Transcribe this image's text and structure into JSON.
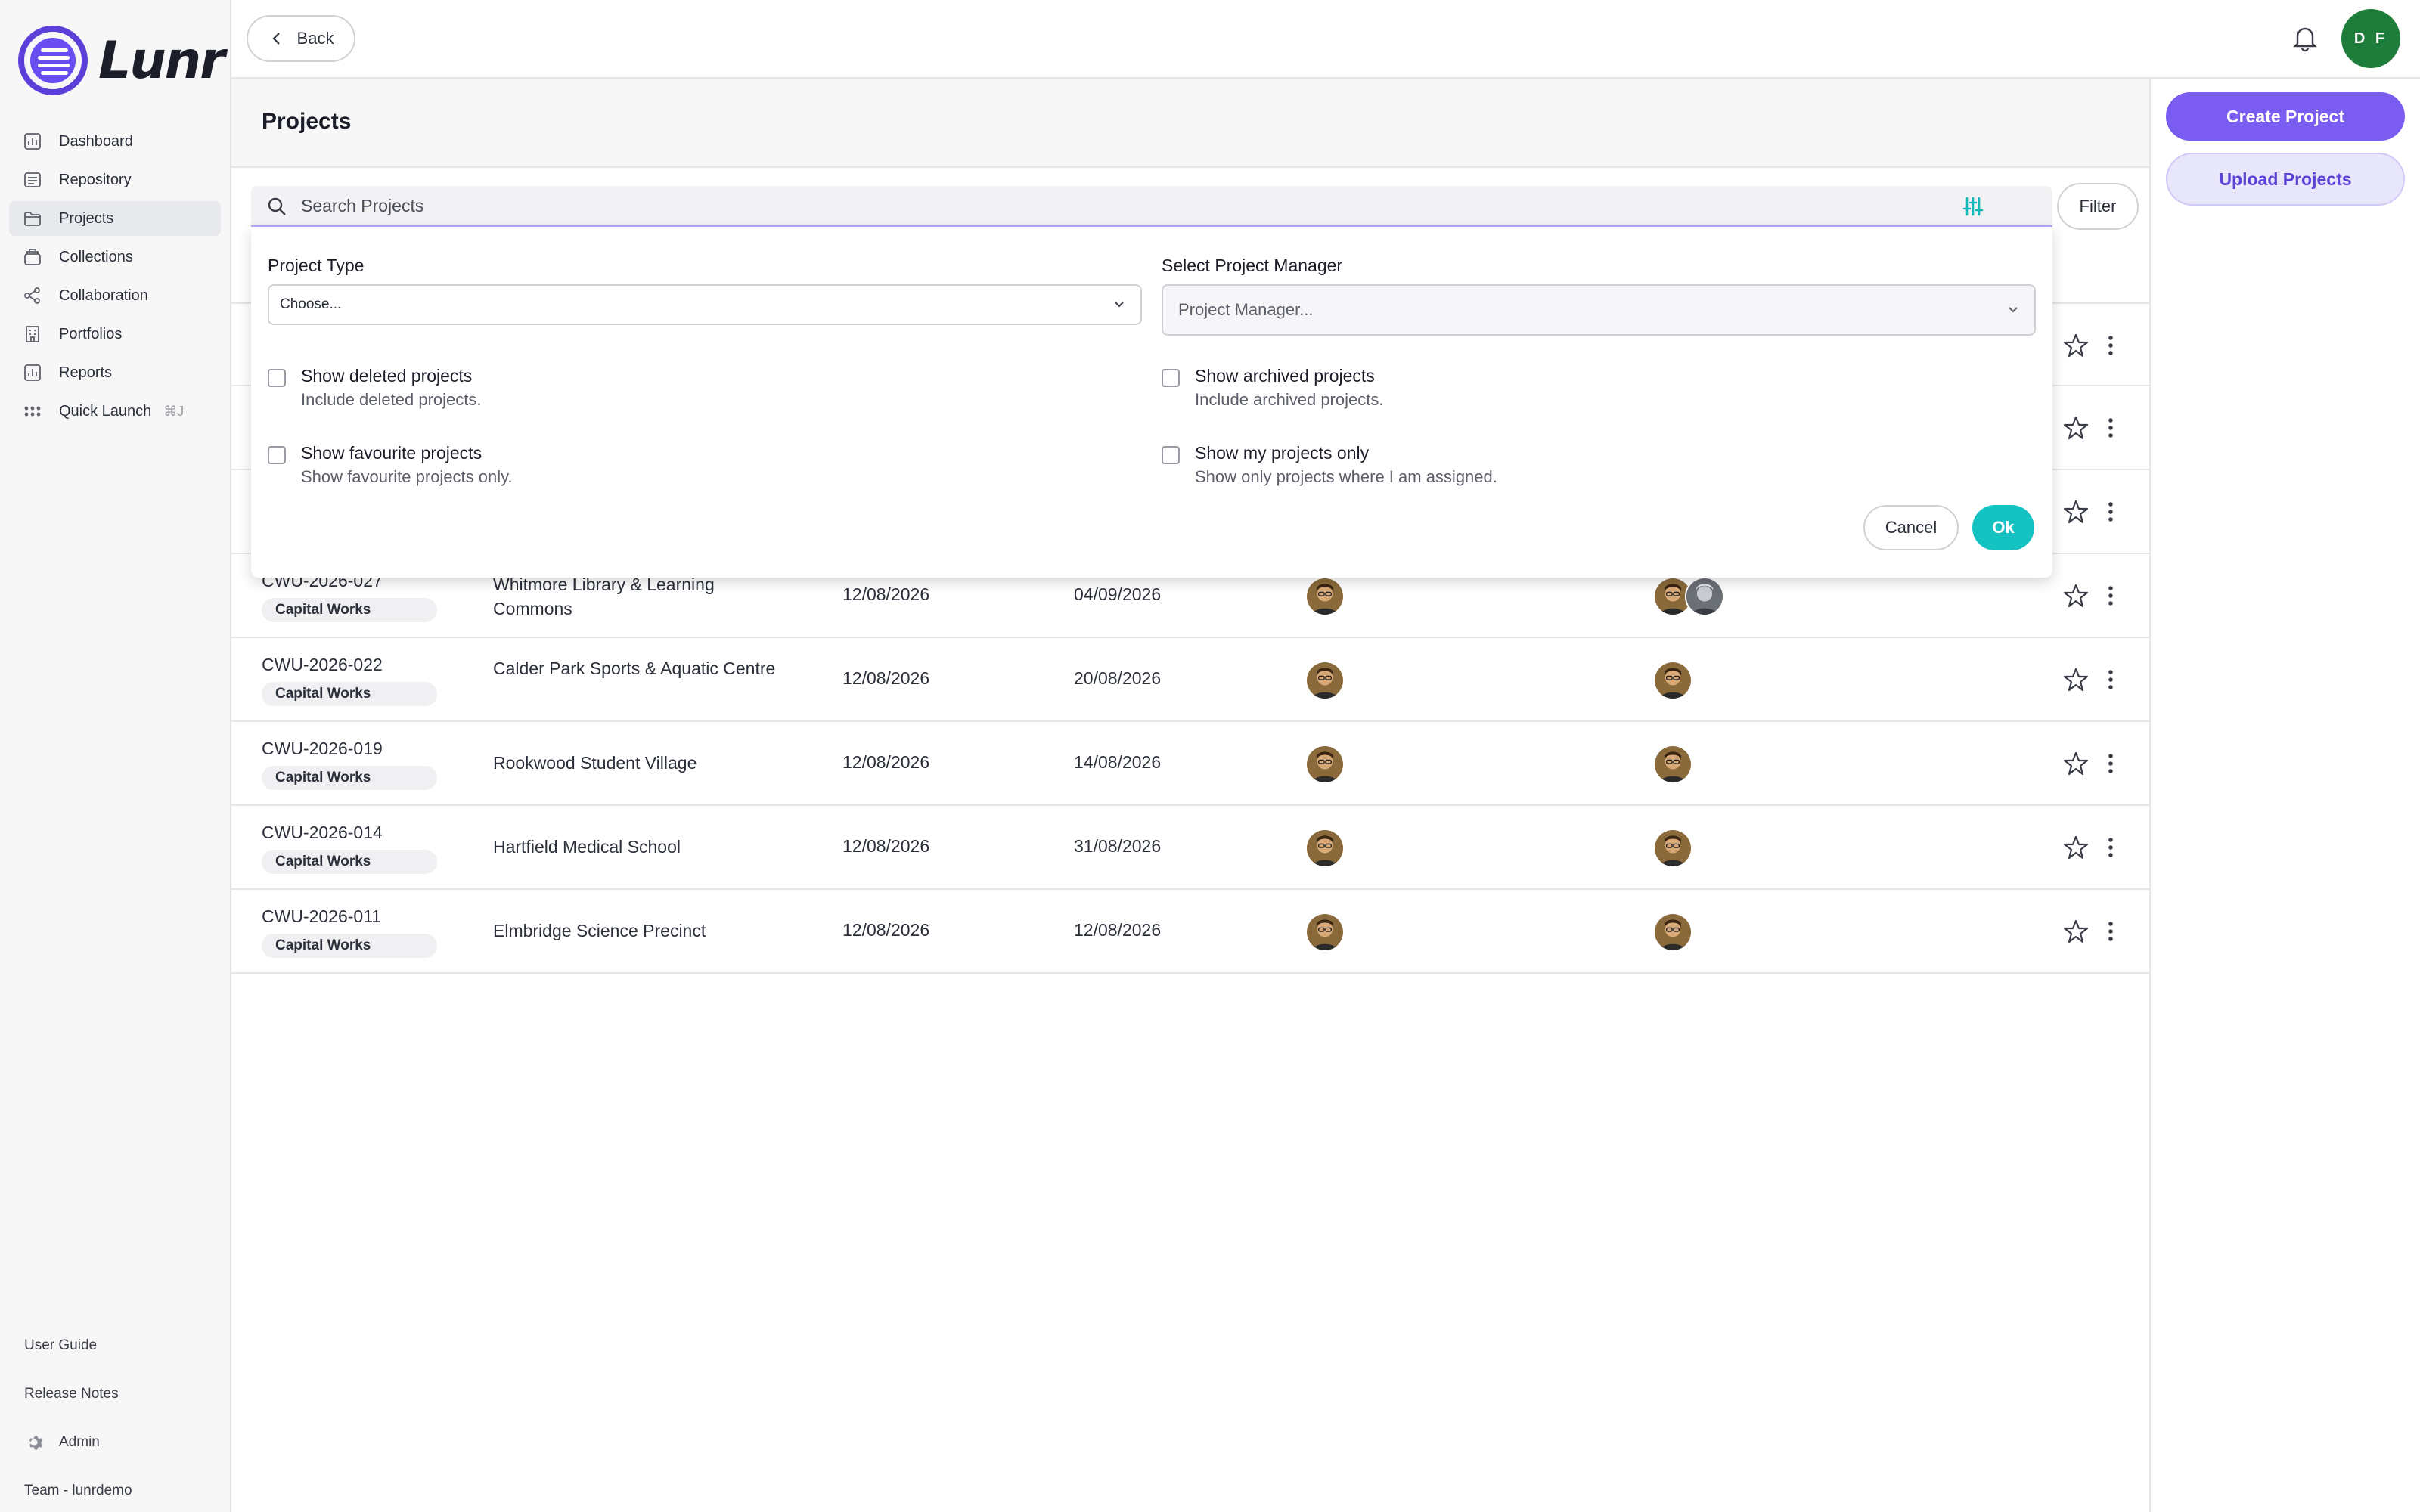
{
  "app": {
    "name": "Lunr"
  },
  "sidebar": {
    "items": [
      {
        "label": "Dashboard",
        "icon": "bar-chart-icon"
      },
      {
        "label": "Repository",
        "icon": "repository-icon"
      },
      {
        "label": "Projects",
        "icon": "folder-icon",
        "active": true
      },
      {
        "label": "Collections",
        "icon": "collections-icon"
      },
      {
        "label": "Collaboration",
        "icon": "share-icon"
      },
      {
        "label": "Portfolios",
        "icon": "building-icon"
      },
      {
        "label": "Reports",
        "icon": "report-icon"
      },
      {
        "label": "Quick Launch",
        "icon": "grid-dots-icon",
        "shortcut": "⌘J"
      }
    ],
    "bottom": {
      "user_guide": "User Guide",
      "release_notes": "Release Notes",
      "admin": "Admin",
      "team": "Team - lunrdemo"
    }
  },
  "topbar": {
    "back_label": "Back",
    "user_initials": "D F"
  },
  "page": {
    "title": "Projects"
  },
  "actions": {
    "create_label": "Create Project",
    "upload_label": "Upload Projects"
  },
  "search": {
    "placeholder": "Search Projects",
    "filter_label": "Filter"
  },
  "filter_panel": {
    "project_type_label": "Project Type",
    "project_type_value": "Choose...",
    "manager_label": "Select Project Manager",
    "manager_placeholder": "Project Manager...",
    "options": {
      "deleted": {
        "title": "Show deleted projects",
        "desc": "Include deleted projects."
      },
      "archived": {
        "title": "Show archived projects",
        "desc": "Include archived projects."
      },
      "favourite": {
        "title": "Show favourite projects",
        "desc": "Show favourite projects only."
      },
      "mine": {
        "title": "Show my projects only",
        "desc": "Show only projects where I am assigned."
      }
    },
    "cancel_label": "Cancel",
    "ok_label": "Ok"
  },
  "rows": [
    {
      "code": "",
      "tag": "",
      "name": "",
      "date1": "",
      "date2": "",
      "team_count": 0
    },
    {
      "code": "",
      "tag": "",
      "name": "",
      "date1": "",
      "date2": "",
      "team_count": 0
    },
    {
      "code": "",
      "tag": "",
      "name": "",
      "date1": "",
      "date2": "",
      "team_count": 0
    },
    {
      "code": "CWU-2026-027",
      "tag": "Capital Works",
      "name": "Whitmore Library & Learning Commons",
      "date1": "12/08/2026",
      "date2": "04/09/2026",
      "team_count": 2
    },
    {
      "code": "CWU-2026-022",
      "tag": "Capital Works",
      "name": "Calder Park Sports & Aquatic Centre",
      "date1": "12/08/2026",
      "date2": "20/08/2026",
      "team_count": 1
    },
    {
      "code": "CWU-2026-019",
      "tag": "Capital Works",
      "name": "Rookwood Student Village",
      "date1": "12/08/2026",
      "date2": "14/08/2026",
      "team_count": 1
    },
    {
      "code": "CWU-2026-014",
      "tag": "Capital Works",
      "name": "Hartfield Medical School",
      "date1": "12/08/2026",
      "date2": "31/08/2026",
      "team_count": 1
    },
    {
      "code": "CWU-2026-011",
      "tag": "Capital Works",
      "name": "Elmbridge Science Precinct",
      "date1": "12/08/2026",
      "date2": "12/08/2026",
      "team_count": 1
    }
  ],
  "colors": {
    "accent": "#7b5cf0",
    "ok": "#14c2c2",
    "avatar": "#1e7d3a"
  }
}
